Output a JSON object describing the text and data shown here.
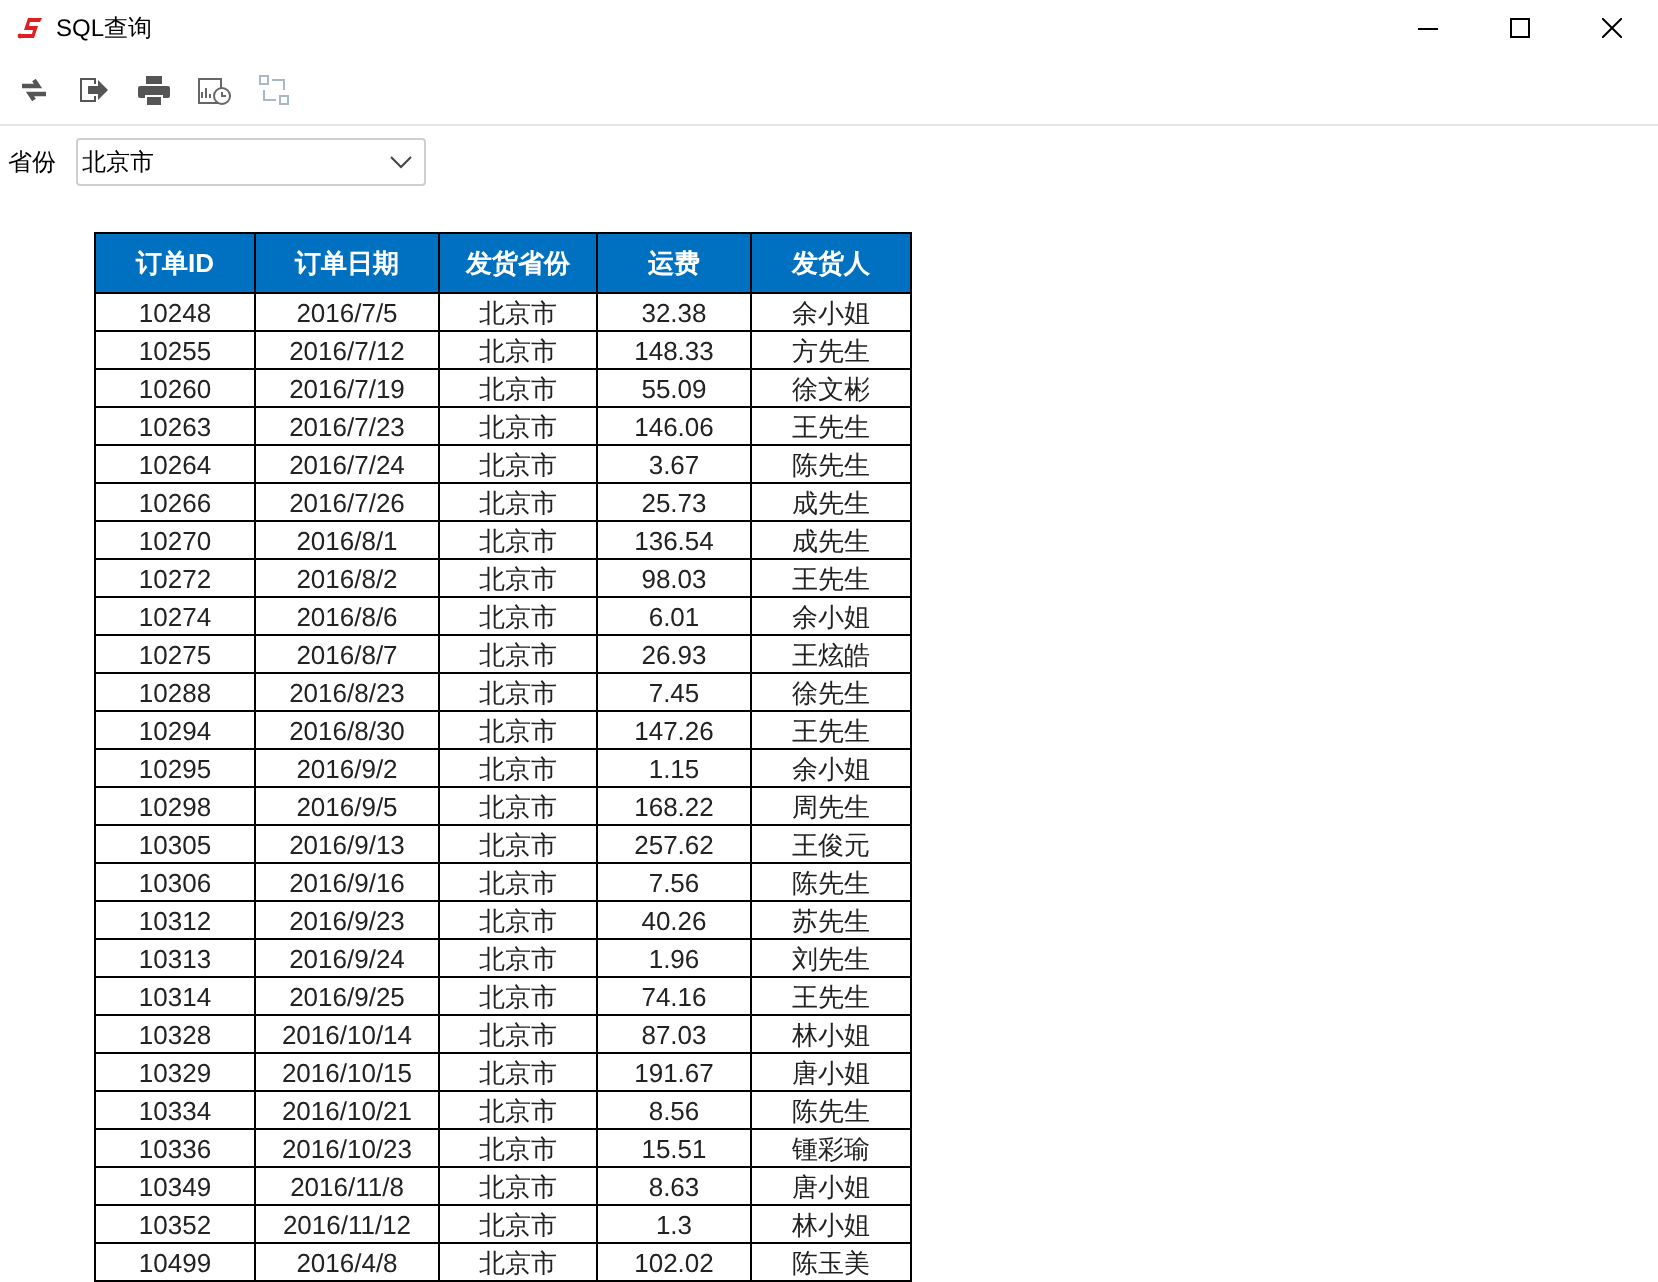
{
  "window": {
    "title": "SQL查询"
  },
  "filter": {
    "label": "省份",
    "value": "北京市"
  },
  "table": {
    "columns": [
      "订单ID",
      "订单日期",
      "发货省份",
      "运费",
      "发货人"
    ],
    "rows": [
      [
        "10248",
        "2016/7/5",
        "北京市",
        "32.38",
        "余小姐"
      ],
      [
        "10255",
        "2016/7/12",
        "北京市",
        "148.33",
        "方先生"
      ],
      [
        "10260",
        "2016/7/19",
        "北京市",
        "55.09",
        "徐文彬"
      ],
      [
        "10263",
        "2016/7/23",
        "北京市",
        "146.06",
        "王先生"
      ],
      [
        "10264",
        "2016/7/24",
        "北京市",
        "3.67",
        "陈先生"
      ],
      [
        "10266",
        "2016/7/26",
        "北京市",
        "25.73",
        "成先生"
      ],
      [
        "10270",
        "2016/8/1",
        "北京市",
        "136.54",
        "成先生"
      ],
      [
        "10272",
        "2016/8/2",
        "北京市",
        "98.03",
        "王先生"
      ],
      [
        "10274",
        "2016/8/6",
        "北京市",
        "6.01",
        "余小姐"
      ],
      [
        "10275",
        "2016/8/7",
        "北京市",
        "26.93",
        "王炫皓"
      ],
      [
        "10288",
        "2016/8/23",
        "北京市",
        "7.45",
        "徐先生"
      ],
      [
        "10294",
        "2016/8/30",
        "北京市",
        "147.26",
        "王先生"
      ],
      [
        "10295",
        "2016/9/2",
        "北京市",
        "1.15",
        "余小姐"
      ],
      [
        "10298",
        "2016/9/5",
        "北京市",
        "168.22",
        "周先生"
      ],
      [
        "10305",
        "2016/9/13",
        "北京市",
        "257.62",
        "王俊元"
      ],
      [
        "10306",
        "2016/9/16",
        "北京市",
        "7.56",
        "陈先生"
      ],
      [
        "10312",
        "2016/9/23",
        "北京市",
        "40.26",
        "苏先生"
      ],
      [
        "10313",
        "2016/9/24",
        "北京市",
        "1.96",
        "刘先生"
      ],
      [
        "10314",
        "2016/9/25",
        "北京市",
        "74.16",
        "王先生"
      ],
      [
        "10328",
        "2016/10/14",
        "北京市",
        "87.03",
        "林小姐"
      ],
      [
        "10329",
        "2016/10/15",
        "北京市",
        "191.67",
        "唐小姐"
      ],
      [
        "10334",
        "2016/10/21",
        "北京市",
        "8.56",
        "陈先生"
      ],
      [
        "10336",
        "2016/10/23",
        "北京市",
        "15.51",
        "锺彩瑜"
      ],
      [
        "10349",
        "2016/11/8",
        "北京市",
        "8.63",
        "唐小姐"
      ],
      [
        "10352",
        "2016/11/12",
        "北京市",
        "1.3",
        "林小姐"
      ],
      [
        "10499",
        "2016/4/8",
        "北京市",
        "102.02",
        "陈玉美"
      ]
    ]
  }
}
